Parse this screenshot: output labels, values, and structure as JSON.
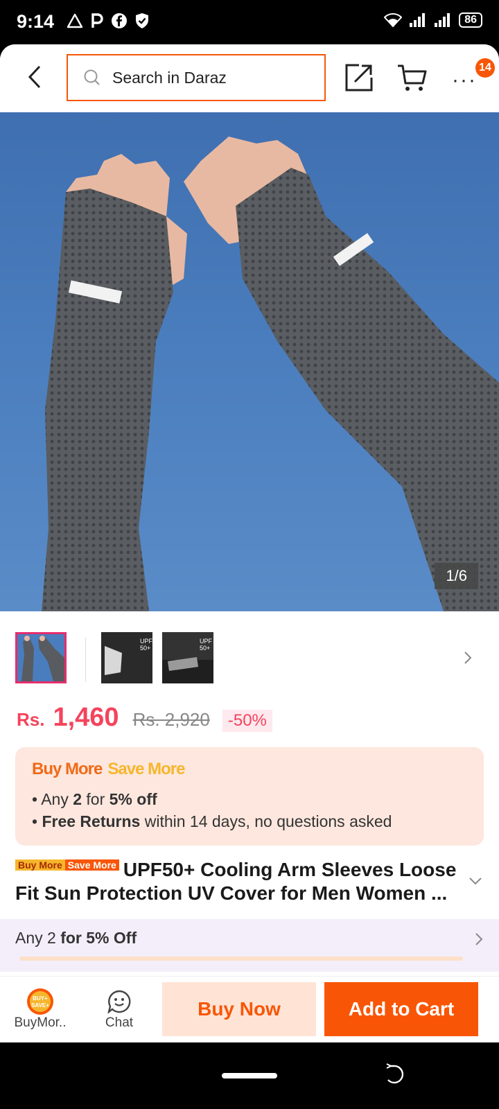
{
  "status_bar": {
    "time": "9:14",
    "battery": "86",
    "left_icons": [
      "warning-triangle-icon",
      "parking-p-icon",
      "facebook-icon",
      "shield-icon"
    ],
    "right_icons": [
      "wifi-icon",
      "signal-icon",
      "signal-icon"
    ]
  },
  "header": {
    "search_placeholder": "Search in Daraz",
    "more_badge": "14"
  },
  "gallery": {
    "counter": "1/6",
    "thumbnails": [
      {
        "label": "",
        "active": true
      },
      {
        "label": "UPF 50+",
        "active": false
      },
      {
        "label": "UPF 50+",
        "active": false
      }
    ]
  },
  "price": {
    "currency": "Rs.",
    "value": "1,460",
    "original": "Rs. 2,920",
    "discount": "-50%"
  },
  "promo": {
    "title_a": "Buy More",
    "title_b": "Save More",
    "line1_pre": "Any",
    "line1_qty": "2",
    "line1_mid": "for",
    "line1_off": "5% off",
    "line2_bold": "Free Returns",
    "line2_rest": "within 14 days, no questions asked"
  },
  "product": {
    "tag_a": "Buy More",
    "tag_b": "Save More",
    "title": "UPF50+ Cooling Arm Sleeves Loose Fit Sun Protection UV Cover for Men Women ..."
  },
  "offer": {
    "pre": "Any 2",
    "bold": "for 5% Off"
  },
  "bottom": {
    "buymore_label": "BuyMor..",
    "buymore_badge_top": "BUY+",
    "buymore_badge_bottom": "SAVE+",
    "chat_label": "Chat",
    "buy_now": "Buy Now",
    "add_to_cart": "Add to Cart"
  },
  "colors": {
    "accent": "#f85606",
    "price": "#f5435c",
    "promo_bg": "#fde7de",
    "offer_bg": "#f4eefb"
  }
}
